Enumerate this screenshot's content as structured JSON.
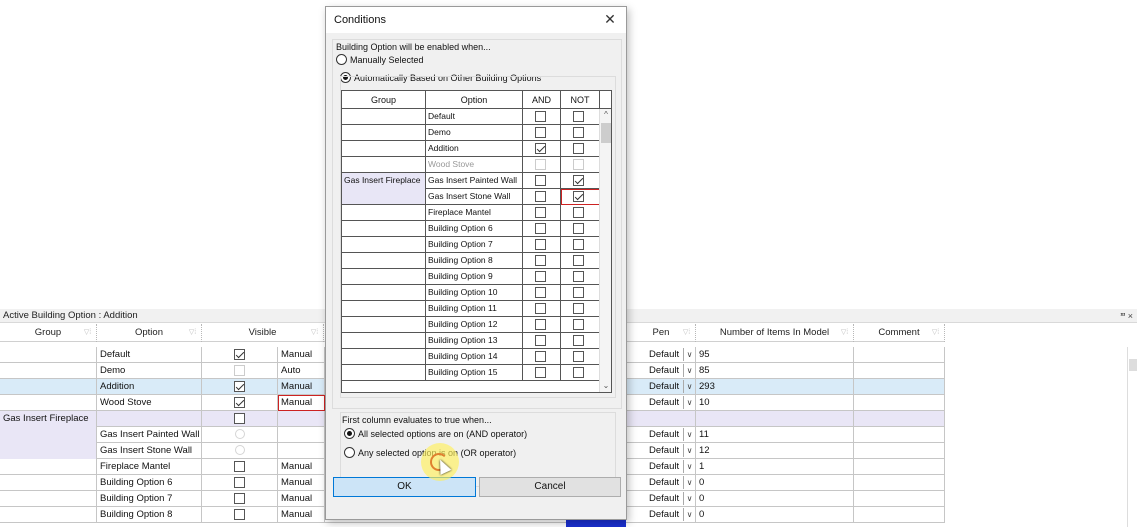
{
  "dialog": {
    "title": "Conditions",
    "enabled_when_label": "Building Option will be enabled when...",
    "radio_manual": "Manually Selected",
    "radio_auto": "Automatically Based on Other Building Options",
    "columns": [
      "Group",
      "Option",
      "AND",
      "NOT"
    ],
    "rows": [
      {
        "group": "",
        "option": "Default",
        "and": false,
        "not": false,
        "dim": false
      },
      {
        "group": "",
        "option": "Demo",
        "and": false,
        "not": false,
        "dim": false
      },
      {
        "group": "",
        "option": "Addition",
        "and": true,
        "not": false,
        "dim": false
      },
      {
        "group": "",
        "option": "Wood Stove",
        "and": false,
        "not": false,
        "dim": true
      },
      {
        "group": "Gas Insert Fireplace",
        "option": "Gas Insert Painted Wall",
        "and": false,
        "not": true,
        "dim": false
      },
      {
        "group": "",
        "option": "Gas Insert Stone Wall",
        "and": false,
        "not": true,
        "dim": false
      },
      {
        "group": "",
        "option": "Fireplace Mantel",
        "and": false,
        "not": false,
        "dim": false
      },
      {
        "group": "",
        "option": "Building Option 6",
        "and": false,
        "not": false,
        "dim": false
      },
      {
        "group": "",
        "option": "Building Option 7",
        "and": false,
        "not": false,
        "dim": false
      },
      {
        "group": "",
        "option": "Building Option 8",
        "and": false,
        "not": false,
        "dim": false
      },
      {
        "group": "",
        "option": "Building Option 9",
        "and": false,
        "not": false,
        "dim": false
      },
      {
        "group": "",
        "option": "Building Option 10",
        "and": false,
        "not": false,
        "dim": false
      },
      {
        "group": "",
        "option": "Building Option 11",
        "and": false,
        "not": false,
        "dim": false
      },
      {
        "group": "",
        "option": "Building Option 12",
        "and": false,
        "not": false,
        "dim": false
      },
      {
        "group": "",
        "option": "Building Option 13",
        "and": false,
        "not": false,
        "dim": false
      },
      {
        "group": "",
        "option": "Building Option 14",
        "and": false,
        "not": false,
        "dim": false
      },
      {
        "group": "",
        "option": "Building Option 15",
        "and": false,
        "not": false,
        "dim": false
      }
    ],
    "first_col_label": "First column evaluates to true when...",
    "radio_and": "All selected options are on (AND operator)",
    "radio_or": "Any selected option is on (OR operator)",
    "ok_label": "OK",
    "cancel_label": "Cancel"
  },
  "panel": {
    "title": "Active Building Option : Addition",
    "pin": "ⱎ ×",
    "headers": {
      "group": "Group",
      "option": "Option",
      "visible": "Visible",
      "pen": "Pen",
      "items": "Number of Items In Model",
      "comment": "Comment"
    },
    "rows": [
      {
        "group": "",
        "option": "Default",
        "visible": "checked",
        "mode": "Manual",
        "pen": "Default",
        "count": "95",
        "style": ""
      },
      {
        "group": "",
        "option": "Demo",
        "visible": "disabled",
        "mode": "Auto",
        "pen": "Default",
        "count": "85",
        "style": ""
      },
      {
        "group": "",
        "option": "Addition",
        "visible": "checked",
        "mode": "Manual",
        "pen": "Default",
        "count": "293",
        "style": "sel"
      },
      {
        "group": "",
        "option": "Wood Stove",
        "visible": "checked",
        "mode": "Manual",
        "pen": "Default",
        "count": "10",
        "style": "red"
      },
      {
        "group": "Gas Insert Fireplace",
        "option": "",
        "visible": "unchecked",
        "mode": "",
        "pen": "",
        "count": "",
        "style": "grp"
      },
      {
        "group": "",
        "option": "Gas Insert Painted Wall",
        "visible": "radio",
        "mode": "",
        "pen": "Default",
        "count": "11",
        "style": "grpchild"
      },
      {
        "group": "",
        "option": "Gas Insert Stone Wall",
        "visible": "radio",
        "mode": "",
        "pen": "Default",
        "count": "12",
        "style": "grpchild"
      },
      {
        "group": "",
        "option": "Fireplace Mantel",
        "visible": "unchecked",
        "mode": "Manual",
        "pen": "Default",
        "count": "1",
        "style": ""
      },
      {
        "group": "",
        "option": "Building Option 6",
        "visible": "unchecked",
        "mode": "Manual",
        "pen": "Default",
        "count": "0",
        "style": ""
      },
      {
        "group": "",
        "option": "Building Option 7",
        "visible": "unchecked",
        "mode": "Manual",
        "pen": "Default",
        "count": "0",
        "style": ""
      },
      {
        "group": "",
        "option": "Building Option 8",
        "visible": "unchecked",
        "mode": "Manual",
        "pen": "Default",
        "count": "0",
        "style": ""
      }
    ]
  },
  "colors": {
    "selection": "#d9ebf8",
    "group_row": "#e9e6f6",
    "ok_button": "#cce4f7",
    "highlight_red": "#cc2222",
    "cursor_highlight": "#fff05a"
  },
  "icons": {
    "close": "close-icon",
    "filter": "filter-icon",
    "dropdown": "chevron-down-icon",
    "pin": "pin-icon"
  }
}
